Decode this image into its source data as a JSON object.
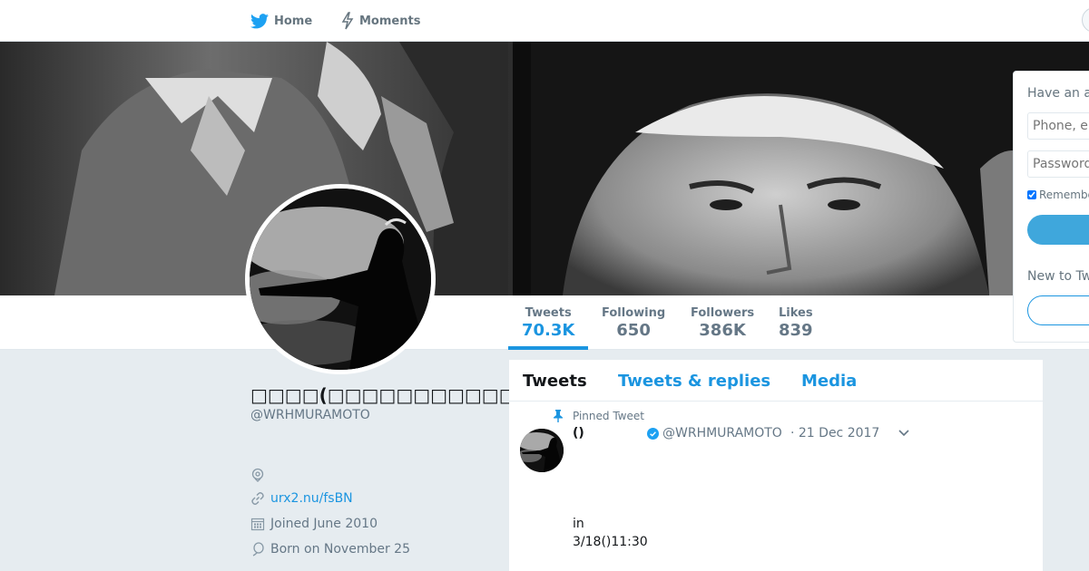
{
  "nav": {
    "home_label": "Home",
    "moments_label": "Moments"
  },
  "stats": [
    {
      "label": "Tweets",
      "value": "70.3K"
    },
    {
      "label": "Following",
      "value": "650"
    },
    {
      "label": "Followers",
      "value": "386K"
    },
    {
      "label": "Likes",
      "value": "839"
    }
  ],
  "profile": {
    "name": "□□□□(□□□□□□□□□□□)",
    "handle": "@WRHMURAMOTO",
    "link": "urx2.nu/fsBN",
    "joined": "Joined June 2010",
    "born": "Born on November 25"
  },
  "timeline": {
    "tabs": [
      "Tweets",
      "Tweets & replies",
      "Media"
    ],
    "pinned_label": "Pinned Tweet",
    "tweet": {
      "name": "()",
      "handle": "@WRHMURAMOTO",
      "date": "· 21 Dec 2017",
      "line1": "in",
      "line2": "3/18()11:30"
    }
  },
  "login": {
    "title": "Have an account?",
    "phone_placeholder": "Phone, email or username",
    "password_placeholder": "Password",
    "remember_label": "Remember me"
  },
  "colors": {
    "accent": "#1b95e0",
    "verified": "#1da1f2",
    "background": "#e6ecf0"
  }
}
